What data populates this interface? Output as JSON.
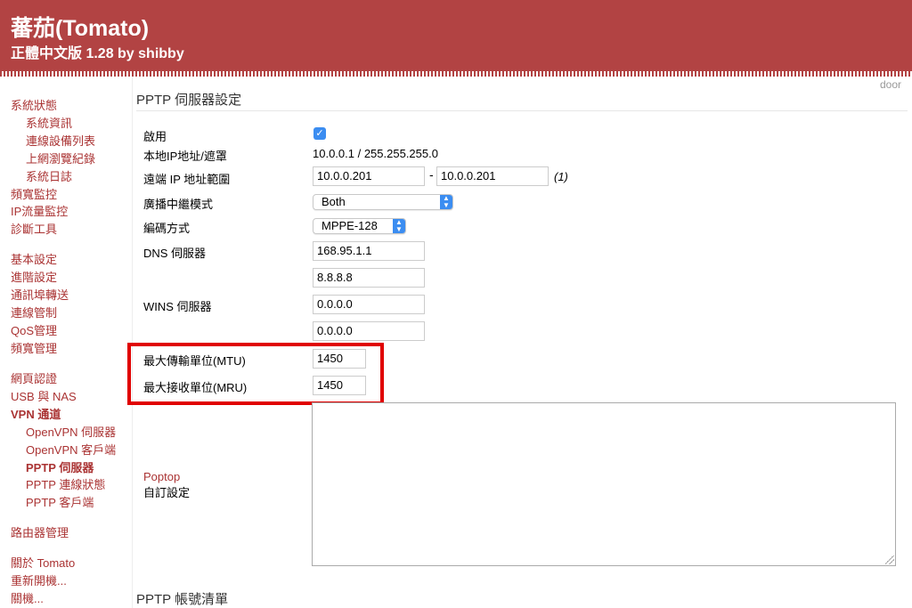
{
  "header": {
    "title": "蕃茄(Tomato)",
    "subtitle": "正體中文版 1.28 by shibby",
    "bg_color": "#b24343"
  },
  "door_label": "door",
  "sidebar": {
    "groups": [
      {
        "items": [
          {
            "label": "系統狀態",
            "sub": false
          },
          {
            "label": "系統資訊",
            "sub": true
          },
          {
            "label": "連線設備列表",
            "sub": true
          },
          {
            "label": "上網瀏覽紀錄",
            "sub": true
          },
          {
            "label": "系統日誌",
            "sub": true
          },
          {
            "label": "頻寬監控",
            "sub": false
          },
          {
            "label": "IP流量監控",
            "sub": false
          },
          {
            "label": "診斷工具",
            "sub": false
          }
        ]
      },
      {
        "items": [
          {
            "label": "基本設定",
            "sub": false
          },
          {
            "label": "進階設定",
            "sub": false
          },
          {
            "label": "通訊埠轉送",
            "sub": false
          },
          {
            "label": "連線管制",
            "sub": false
          },
          {
            "label": "QoS管理",
            "sub": false
          },
          {
            "label": "頻寬管理",
            "sub": false
          }
        ]
      },
      {
        "items": [
          {
            "label": "網頁認證",
            "sub": false
          },
          {
            "label": "USB 與 NAS",
            "sub": false
          },
          {
            "label": "VPN 通道",
            "sub": false,
            "active": true
          },
          {
            "label": "OpenVPN 伺服器",
            "sub": true
          },
          {
            "label": "OpenVPN 客戶端",
            "sub": true
          },
          {
            "label": "PPTP 伺服器",
            "sub": true,
            "active": true
          },
          {
            "label": "PPTP 連線狀態",
            "sub": true
          },
          {
            "label": "PPTP 客戶端",
            "sub": true
          }
        ]
      },
      {
        "items": [
          {
            "label": "路由器管理",
            "sub": false
          }
        ]
      },
      {
        "items": [
          {
            "label": "關於 Tomato",
            "sub": false
          },
          {
            "label": "重新開機...",
            "sub": false
          },
          {
            "label": "關機...",
            "sub": false
          }
        ]
      }
    ]
  },
  "pptp": {
    "section_title": "PPTP 伺服器設定",
    "enable_label": "啟用",
    "enable_checked": true,
    "local_ip_label": "本地IP地址/遮罩",
    "local_ip_value": "10.0.0.1 / 255.255.255.0",
    "remote_range_label": "遠端 IP 地址範圍",
    "remote_start": "10.0.0.201",
    "remote_dash": "-",
    "remote_end": "10.0.0.201",
    "remote_note": "(1)",
    "broadcast_label": "廣播中繼模式",
    "broadcast_value": "Both",
    "encryption_label": "編碼方式",
    "encryption_value": "MPPE-128",
    "dns_label": "DNS 伺服器",
    "dns1": "168.95.1.1",
    "dns2": "8.8.8.8",
    "wins_label": "WINS 伺服器",
    "wins1": "0.0.0.0",
    "wins2": "0.0.0.0",
    "mtu_label": "最大傳輸單位(MTU)",
    "mtu_value": "1450",
    "mru_label": "最大接收單位(MRU)",
    "mru_value": "1450",
    "custom_link": "Poptop",
    "custom_label": "自訂設定",
    "custom_value": ""
  },
  "accounts": {
    "section_title": "PPTP 帳號清單"
  },
  "colors": {
    "accent": "#a33333",
    "highlight": "#e00000",
    "checkbox": "#3b8df1"
  }
}
